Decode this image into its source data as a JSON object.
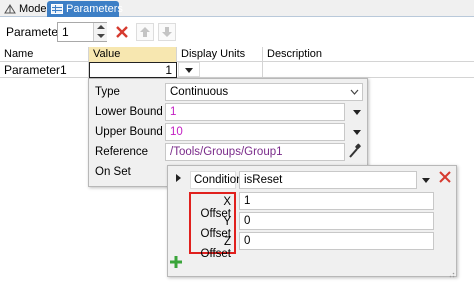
{
  "tabs": [
    {
      "label": "Model"
    },
    {
      "label": "Parameters"
    }
  ],
  "toolbar": {
    "parameters_label": "Parameters",
    "parameters_count": "1"
  },
  "table": {
    "headers": [
      "Name",
      "Value",
      "Display Units",
      "Description"
    ],
    "rows": [
      {
        "name": "Parameter1",
        "value": "1",
        "units": "",
        "description": ""
      }
    ]
  },
  "param_popup": {
    "type_label": "Type",
    "type_value": "Continuous",
    "lower_label": "Lower Bound",
    "lower_value": "1",
    "upper_label": "Upper Bound",
    "upper_value": "10",
    "reference_label": "Reference",
    "reference_value": "/Tools/Groups/Group1",
    "onset_label": "On Set"
  },
  "onset_popup": {
    "condition_label": "Condition",
    "condition_value": "isReset",
    "x_label": "X Offset",
    "x_value": "1",
    "y_label": "Y Offset",
    "y_value": "0",
    "z_label": "Z Offset",
    "z_value": "0"
  },
  "colors": {
    "tab_active": "#3d7fc6",
    "value_header": "#f7e7b0",
    "bound_text": "#c21fc2",
    "reference_text": "#7a2b8a",
    "highlight_box": "#e0201d",
    "delete_red": "#d63a2f",
    "add_green": "#3aa53a"
  }
}
